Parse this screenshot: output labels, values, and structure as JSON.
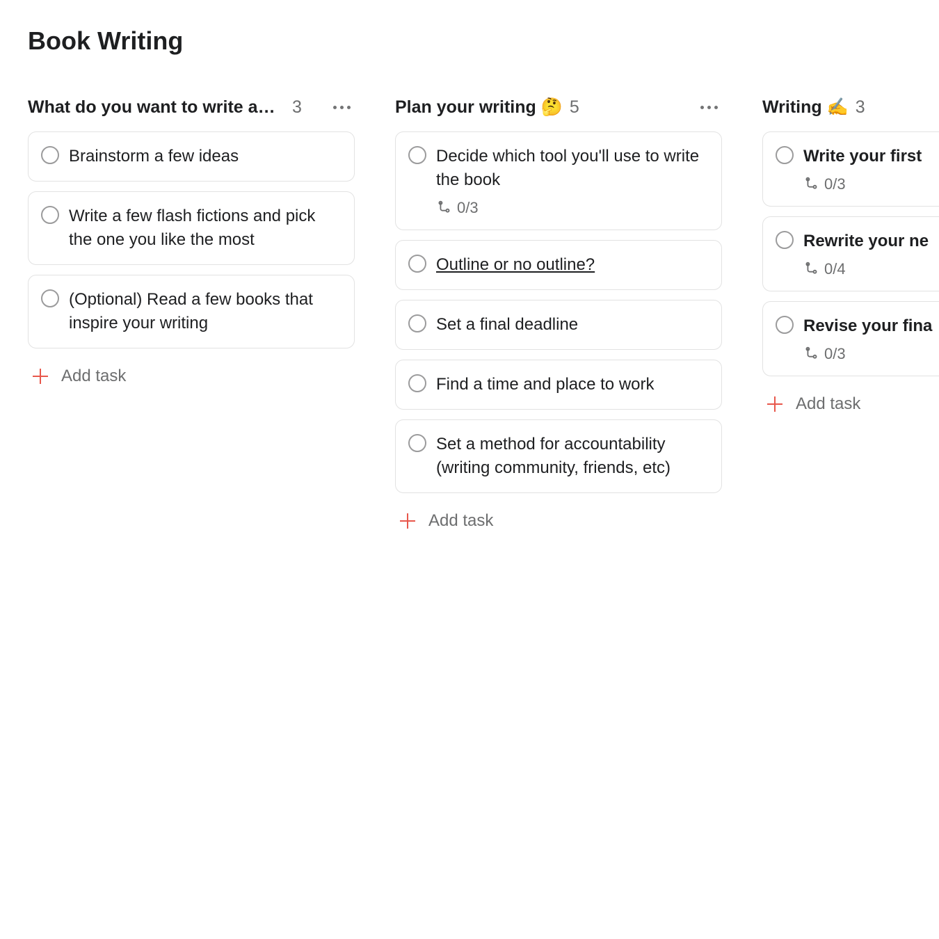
{
  "title": "Book Writing",
  "addTaskLabel": "Add task",
  "columns": [
    {
      "title": "What do you want to write ab…",
      "count": "3",
      "showMore": true,
      "tasks": [
        {
          "title": "Brainstorm a few ideas",
          "bold": false,
          "underline": false,
          "sub": null
        },
        {
          "title": "Write a few flash fictions and pick the one you like the most",
          "bold": false,
          "underline": false,
          "sub": null
        },
        {
          "title": "(Optional) Read a few books that inspire your writing",
          "bold": false,
          "underline": false,
          "sub": null
        }
      ]
    },
    {
      "title": "Plan your writing 🤔",
      "count": "5",
      "showMore": true,
      "tasks": [
        {
          "title": "Decide which tool you'll use to write the book",
          "bold": false,
          "underline": false,
          "sub": "0/3"
        },
        {
          "title": "Outline or no outline?",
          "bold": false,
          "underline": true,
          "sub": null
        },
        {
          "title": "Set a final deadline",
          "bold": false,
          "underline": false,
          "sub": null
        },
        {
          "title": "Find a time and place to work",
          "bold": false,
          "underline": false,
          "sub": null
        },
        {
          "title": "Set a method for accountability (writing community, friends, etc)",
          "bold": false,
          "underline": false,
          "sub": null
        }
      ]
    },
    {
      "title": "Writing ✍️",
      "count": "3",
      "showMore": false,
      "tasks": [
        {
          "title": "Write your first",
          "bold": true,
          "underline": false,
          "sub": "0/3"
        },
        {
          "title": "Rewrite your ne",
          "bold": true,
          "underline": false,
          "sub": "0/4"
        },
        {
          "title": "Revise your fina",
          "bold": true,
          "underline": false,
          "sub": "0/3"
        }
      ]
    }
  ]
}
